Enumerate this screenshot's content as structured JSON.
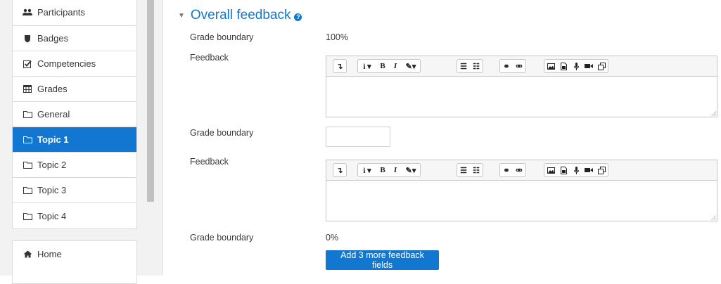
{
  "sidebar": {
    "items": [
      {
        "label": "Participants",
        "icon": "users-icon"
      },
      {
        "label": "Badges",
        "icon": "shield-icon"
      },
      {
        "label": "Competencies",
        "icon": "checkbox-icon"
      },
      {
        "label": "Grades",
        "icon": "table-icon"
      },
      {
        "label": "General",
        "icon": "folder-icon"
      },
      {
        "label": "Topic 1",
        "icon": "folder-icon",
        "active": true
      },
      {
        "label": "Topic 2",
        "icon": "folder-icon"
      },
      {
        "label": "Topic 3",
        "icon": "folder-icon"
      },
      {
        "label": "Topic 4",
        "icon": "folder-icon"
      }
    ],
    "home_label": "Home"
  },
  "section": {
    "title": "Overall feedback",
    "help_icon": "help-icon",
    "grade_boundary_label": "Grade boundary",
    "feedback_label": "Feedback",
    "boundary_top_value": "100%",
    "boundary_bottom_value": "0%",
    "add_button_label": "Add 3 more feedback fields"
  },
  "colors": {
    "accent": "#1177d1",
    "sidebar_bg": "#f2f2f2"
  },
  "editor_toolbar_icons": [
    "collapse-icon",
    "paragraph-style-icon",
    "bold-icon",
    "italic-icon",
    "text-color-icon",
    "unordered-list-icon",
    "ordered-list-icon",
    "link-icon",
    "unlink-icon",
    "image-icon",
    "media-icon",
    "record-audio-icon",
    "record-video-icon",
    "manage-files-icon"
  ]
}
